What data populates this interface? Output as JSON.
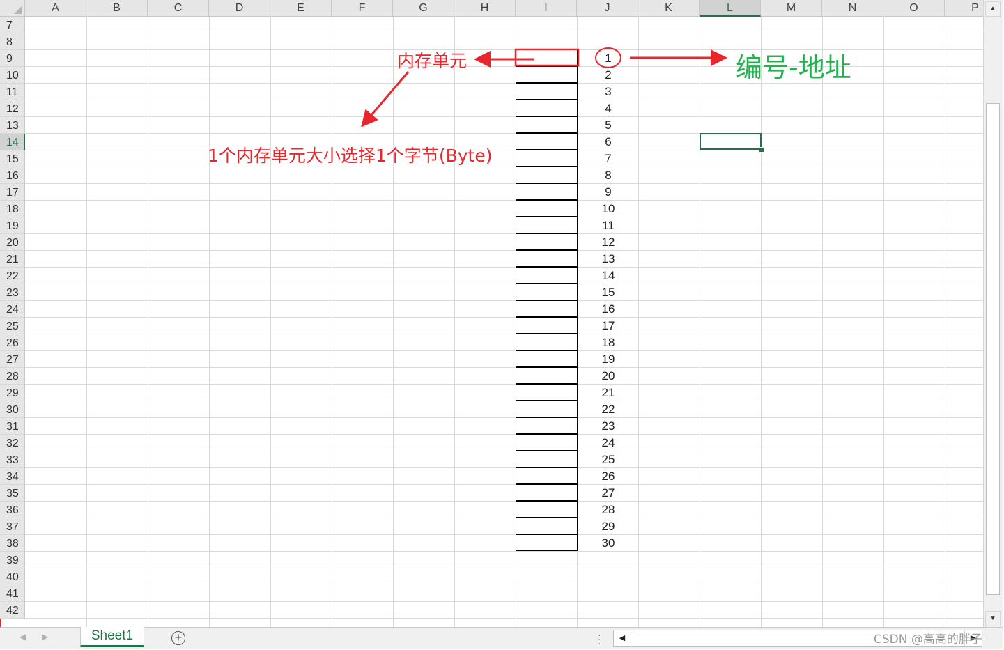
{
  "columns": [
    "A",
    "B",
    "C",
    "D",
    "E",
    "F",
    "G",
    "H",
    "I",
    "J",
    "K",
    "L",
    "M",
    "N",
    "O",
    "P"
  ],
  "active_column": "L",
  "rows": [
    "7",
    "8",
    "9",
    "10",
    "11",
    "12",
    "13",
    "14",
    "15",
    "16",
    "17",
    "18",
    "19",
    "20",
    "21",
    "22",
    "23",
    "24",
    "25",
    "26",
    "27",
    "28",
    "29",
    "30",
    "31",
    "32",
    "33",
    "34",
    "35",
    "36",
    "37",
    "38",
    "39",
    "40",
    "41",
    "42"
  ],
  "active_row": "14",
  "memory_addresses": [
    "1",
    "2",
    "3",
    "4",
    "5",
    "6",
    "7",
    "8",
    "9",
    "10",
    "11",
    "12",
    "13",
    "14",
    "15",
    "16",
    "17",
    "18",
    "19",
    "20",
    "21",
    "22",
    "23",
    "24",
    "25",
    "26",
    "27",
    "28",
    "29",
    "30"
  ],
  "annotations": {
    "memory_unit": "内存单元",
    "unit_size": "1个内存单元大小选择1个字节(Byte)",
    "number_address": "编号-地址"
  },
  "colors": {
    "annotation": "#e8262c",
    "address_label": "#22b14c",
    "excel_green": "#217346"
  },
  "sheet_tabs": [
    "Sheet1"
  ],
  "add_sheet_icon": "plus-circle-icon",
  "watermark": "CSDN @高高的胖子"
}
